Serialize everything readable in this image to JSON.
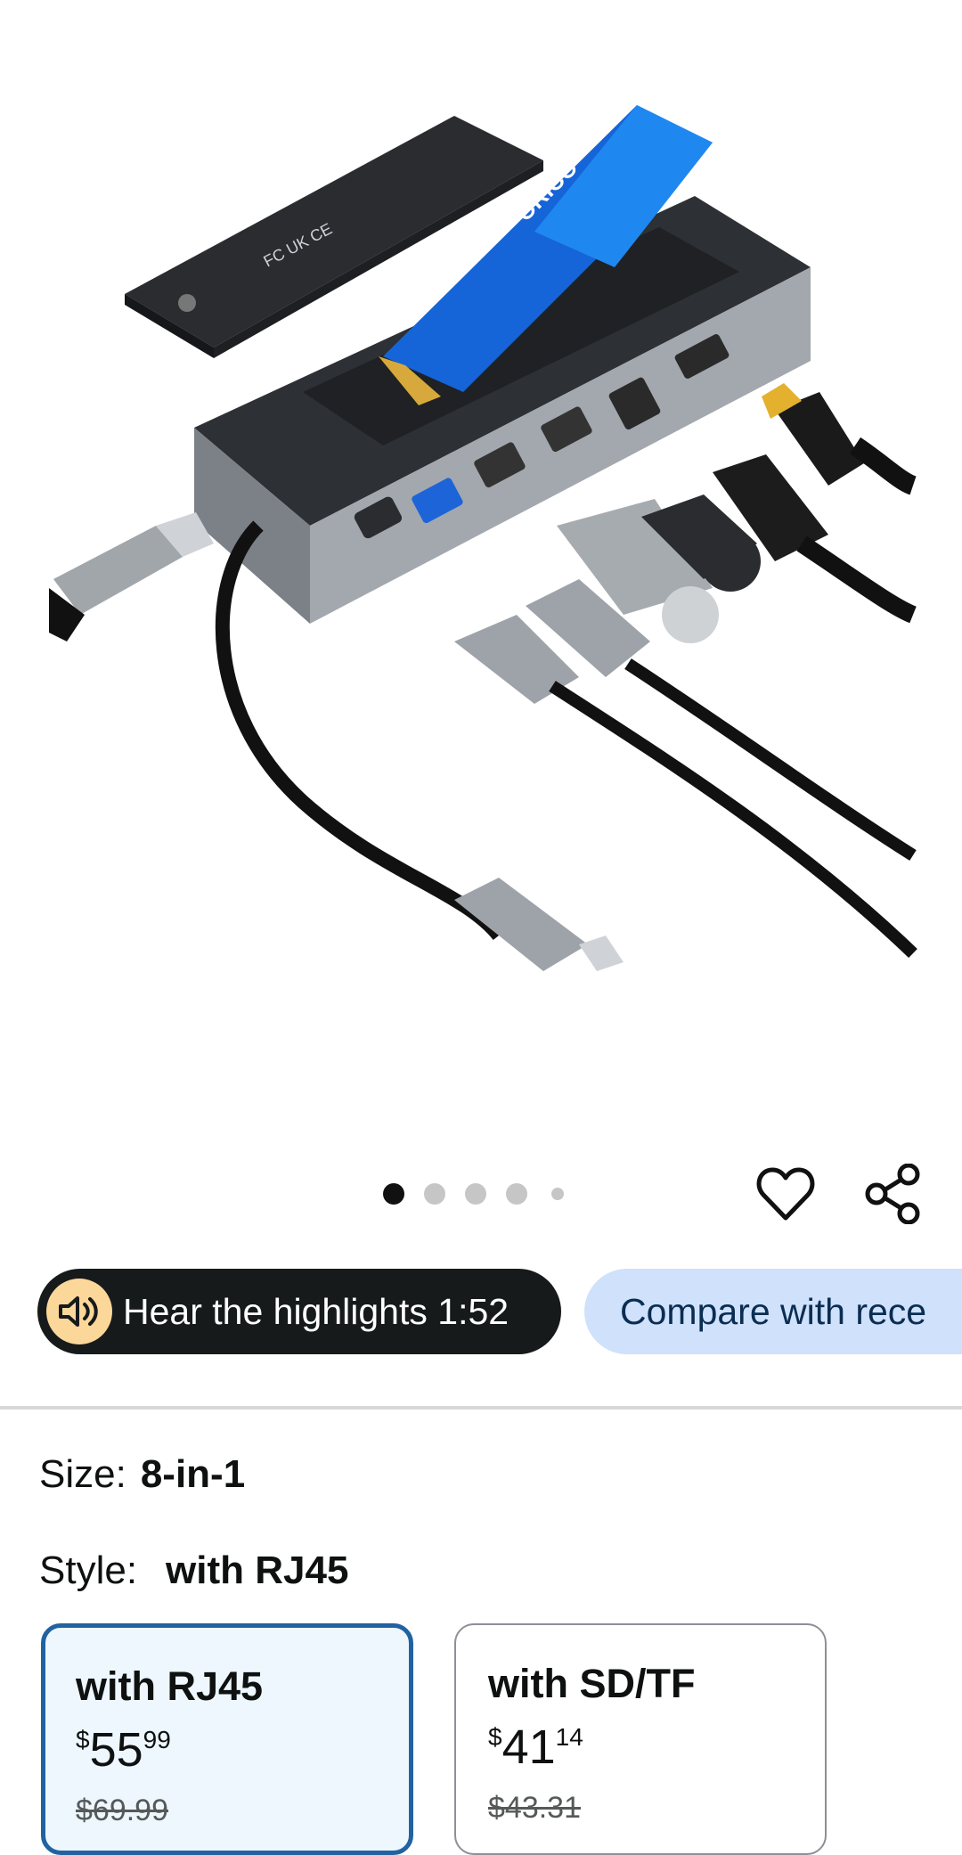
{
  "product": {
    "image_alt": "USB-C docking station with M.2 SSD enclosure and cables"
  },
  "carousel": {
    "count": 5,
    "active_index": 0
  },
  "actions": {
    "favorite_icon": "heart-icon",
    "share_icon": "share-icon"
  },
  "highlights": {
    "label": "Hear the highlights 1:52",
    "icon": "speaker-icon",
    "accent": "#fbd79a"
  },
  "compare": {
    "label": "Compare with rece"
  },
  "size": {
    "label": "Size:",
    "value": "8-in-1"
  },
  "style": {
    "label": "Style:",
    "value": "with RJ45"
  },
  "options": [
    {
      "name": "with RJ45",
      "currency": "$",
      "whole": "55",
      "fraction": "99",
      "list_price": "$69.99",
      "selected": true
    },
    {
      "name": "with SD/TF",
      "currency": "$",
      "whole": "41",
      "fraction": "14",
      "list_price": "$43.31",
      "selected": false
    }
  ],
  "colors": {
    "selected_border": "#2162a1",
    "selected_bg": "#edf7fd",
    "pill_dark": "#161a1a",
    "pill_blue": "#cfe1fb"
  }
}
